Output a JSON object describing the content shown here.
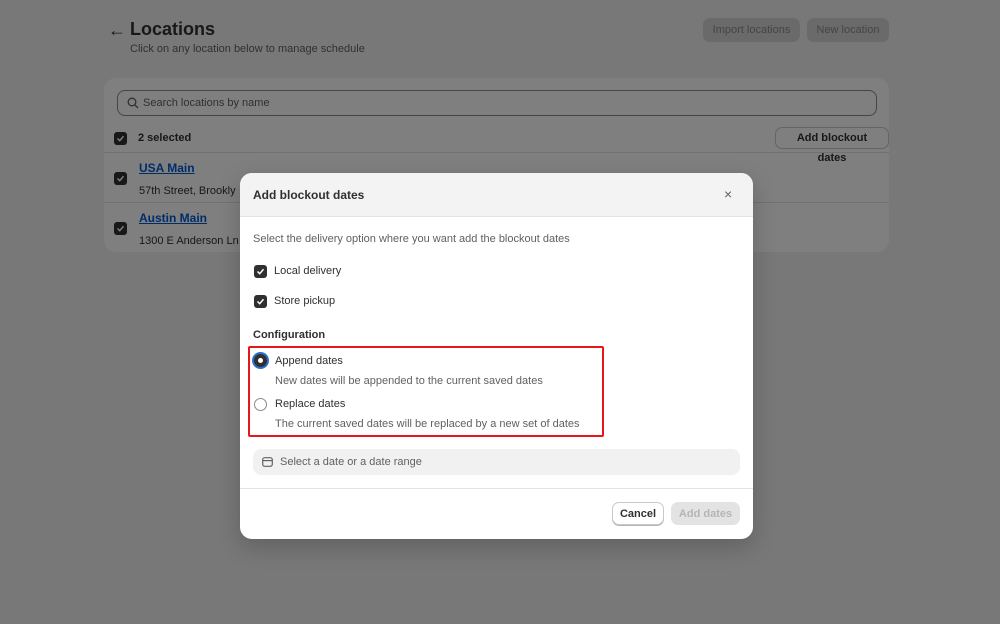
{
  "header": {
    "title": "Locations",
    "subtitle": "Click on any location below to manage schedule",
    "import_label": "Import locations",
    "new_label": "New location"
  },
  "search": {
    "placeholder": "Search locations by name"
  },
  "selection": {
    "count_text": "2 selected",
    "action_label": "Add blockout dates"
  },
  "locations": [
    {
      "name": "USA Main",
      "address": "57th Street, Brookly"
    },
    {
      "name": "Austin Main",
      "address": "1300 E Anderson Ln"
    }
  ],
  "modal": {
    "title": "Add blockout dates",
    "close_icon": "×",
    "description": "Select the delivery option where you want add the blockout dates",
    "options": [
      {
        "label": "Local delivery",
        "checked": true
      },
      {
        "label": "Store pickup",
        "checked": true
      }
    ],
    "configuration_title": "Configuration",
    "radios": [
      {
        "label": "Append dates",
        "help": "New dates will be appended to the current saved dates",
        "selected": true
      },
      {
        "label": "Replace dates",
        "help": "The current saved dates will be replaced by a new set of dates",
        "selected": false
      }
    ],
    "date_placeholder": "Select a date or a date range",
    "cancel_label": "Cancel",
    "add_label": "Add dates"
  },
  "colors": {
    "link": "#005bd3",
    "highlight": "#e8161b",
    "focus_ring": "#2c6ecb"
  }
}
